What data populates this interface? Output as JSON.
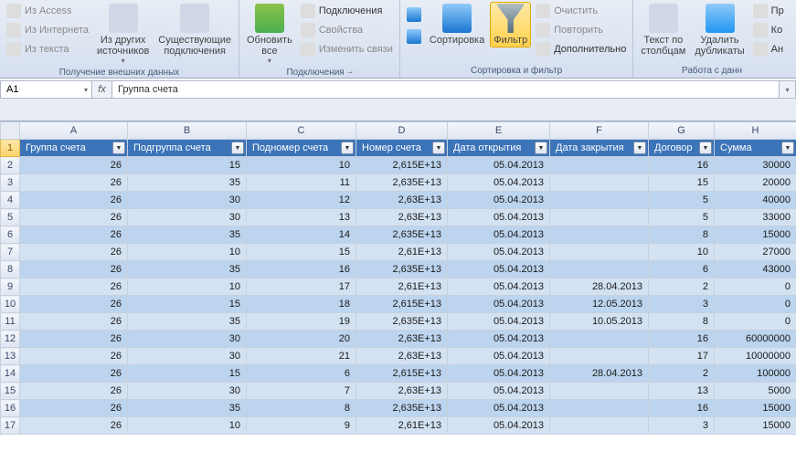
{
  "ribbon": {
    "group_ext_title": "Получение внешних данных",
    "ext_access": "Из Access",
    "ext_web": "Из Интернета",
    "ext_text": "Из текста",
    "ext_other1": "Из других",
    "ext_other2": "источников",
    "ext_exist1": "Существующие",
    "ext_exist2": "подключения",
    "group_conn_title": "Подключения",
    "refresh1": "Обновить",
    "refresh2": "все",
    "conn_connections": "Подключения",
    "conn_props": "Свойства",
    "conn_edit": "Изменить связи",
    "group_sort_title": "Сортировка и фильтр",
    "sort_az": "А↓Я",
    "sort_za": "Я↓А",
    "sort_btn": "Сортировка",
    "filter_btn": "Фильтр",
    "filter_clear": "Очистить",
    "filter_reapply": "Повторить",
    "filter_adv": "Дополнительно",
    "group_data_title": "Работа с данн",
    "text_cols1": "Текст по",
    "text_cols2": "столбцам",
    "dedup1": "Удалить",
    "dedup2": "дубликаты",
    "extra_p": "Пр",
    "extra_k": "Ко",
    "extra_a": "Ан"
  },
  "formula_bar": {
    "cell_ref": "A1",
    "fx": "fx",
    "value": "Группа счета"
  },
  "columns": [
    "A",
    "B",
    "C",
    "D",
    "E",
    "F",
    "G",
    "H"
  ],
  "headers": [
    "Группа счета",
    "Подгруппа счета",
    "Подномер счета",
    "Номер счета",
    "Дата открытия",
    "Дата закрытия",
    "Договор",
    "Сумма"
  ],
  "rows": [
    {
      "n": 2,
      "c": [
        "26",
        "15",
        "10",
        "2,615E+13",
        "05.04.2013",
        "",
        "16",
        "30000"
      ]
    },
    {
      "n": 3,
      "c": [
        "26",
        "35",
        "11",
        "2,635E+13",
        "05.04.2013",
        "",
        "15",
        "20000"
      ]
    },
    {
      "n": 4,
      "c": [
        "26",
        "30",
        "12",
        "2,63E+13",
        "05.04.2013",
        "",
        "5",
        "40000"
      ]
    },
    {
      "n": 5,
      "c": [
        "26",
        "30",
        "13",
        "2,63E+13",
        "05.04.2013",
        "",
        "5",
        "33000"
      ]
    },
    {
      "n": 6,
      "c": [
        "26",
        "35",
        "14",
        "2,635E+13",
        "05.04.2013",
        "",
        "8",
        "15000"
      ]
    },
    {
      "n": 7,
      "c": [
        "26",
        "10",
        "15",
        "2,61E+13",
        "05.04.2013",
        "",
        "10",
        "27000"
      ]
    },
    {
      "n": 8,
      "c": [
        "26",
        "35",
        "16",
        "2,635E+13",
        "05.04.2013",
        "",
        "6",
        "43000"
      ]
    },
    {
      "n": 9,
      "c": [
        "26",
        "10",
        "17",
        "2,61E+13",
        "05.04.2013",
        "28.04.2013",
        "2",
        "0"
      ]
    },
    {
      "n": 10,
      "c": [
        "26",
        "15",
        "18",
        "2,615E+13",
        "05.04.2013",
        "12.05.2013",
        "3",
        "0"
      ]
    },
    {
      "n": 11,
      "c": [
        "26",
        "35",
        "19",
        "2,635E+13",
        "05.04.2013",
        "10.05.2013",
        "8",
        "0"
      ]
    },
    {
      "n": 12,
      "c": [
        "26",
        "30",
        "20",
        "2,63E+13",
        "05.04.2013",
        "",
        "16",
        "60000000"
      ]
    },
    {
      "n": 13,
      "c": [
        "26",
        "30",
        "21",
        "2,63E+13",
        "05.04.2013",
        "",
        "17",
        "10000000"
      ]
    },
    {
      "n": 14,
      "c": [
        "26",
        "15",
        "6",
        "2,615E+13",
        "05.04.2013",
        "28.04.2013",
        "2",
        "100000"
      ]
    },
    {
      "n": 15,
      "c": [
        "26",
        "30",
        "7",
        "2,63E+13",
        "05.04.2013",
        "",
        "13",
        "5000"
      ]
    },
    {
      "n": 16,
      "c": [
        "26",
        "35",
        "8",
        "2,635E+13",
        "05.04.2013",
        "",
        "16",
        "15000"
      ]
    },
    {
      "n": 17,
      "c": [
        "26",
        "10",
        "9",
        "2,61E+13",
        "05.04.2013",
        "",
        "3",
        "15000"
      ]
    }
  ]
}
